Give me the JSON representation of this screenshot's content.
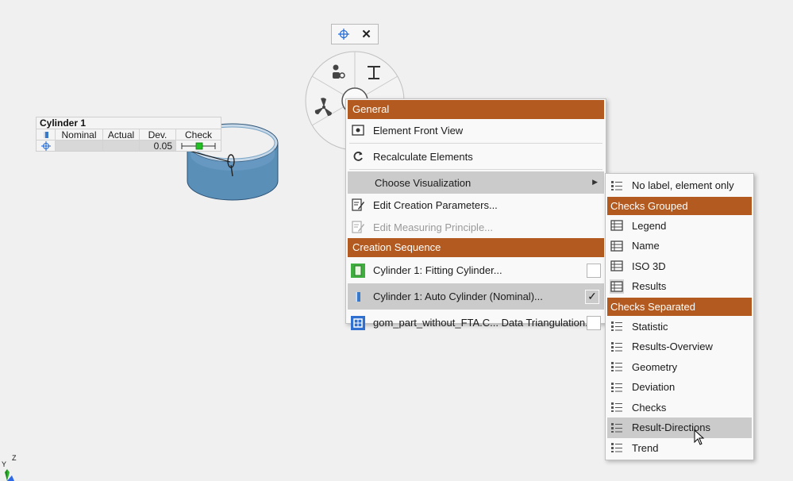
{
  "label_table": {
    "title": "Cylinder 1",
    "headers": [
      "Nominal",
      "Actual",
      "Dev.",
      "Check"
    ],
    "values": {
      "nominal": "",
      "actual": "",
      "dev": "0.05"
    }
  },
  "mini_toolbar": {
    "close_label": "✕"
  },
  "context_menu": {
    "section_general": "General",
    "element_front_view": "Element Front View",
    "recalculate_elements": "Recalculate Elements",
    "choose_visualization": "Choose Visualization",
    "edit_creation_parameters": "Edit Creation Parameters...",
    "edit_measuring_principle": "Edit Measuring Principle...",
    "section_creation_sequence": "Creation Sequence",
    "sequence": [
      {
        "label": "Cylinder 1: Fitting Cylinder...",
        "checked": false
      },
      {
        "label": "Cylinder 1: Auto Cylinder (Nominal)...",
        "checked": true
      },
      {
        "label": "gom_part_without_FTA.C... Data Triangulation...",
        "checked": false
      }
    ],
    "check_mark": "✓"
  },
  "visualization_menu": {
    "no_label": "No label, element only",
    "section_checks_grouped": "Checks Grouped",
    "grouped": [
      "Legend",
      "Name",
      "ISO 3D",
      "Results"
    ],
    "section_checks_separated": "Checks Separated",
    "separated": [
      "Statistic",
      "Results-Overview",
      "Geometry",
      "Deviation",
      "Checks",
      "Result-Directions",
      "Trend"
    ]
  },
  "axes": {
    "y": "Y",
    "z": "Z"
  },
  "colors": {
    "menu_header": "#b25a1f",
    "highlight": "#cbcbcb",
    "cylinder": "#5a8fb8",
    "accent_blue": "#2a6fd6",
    "check_green": "#22c022"
  }
}
